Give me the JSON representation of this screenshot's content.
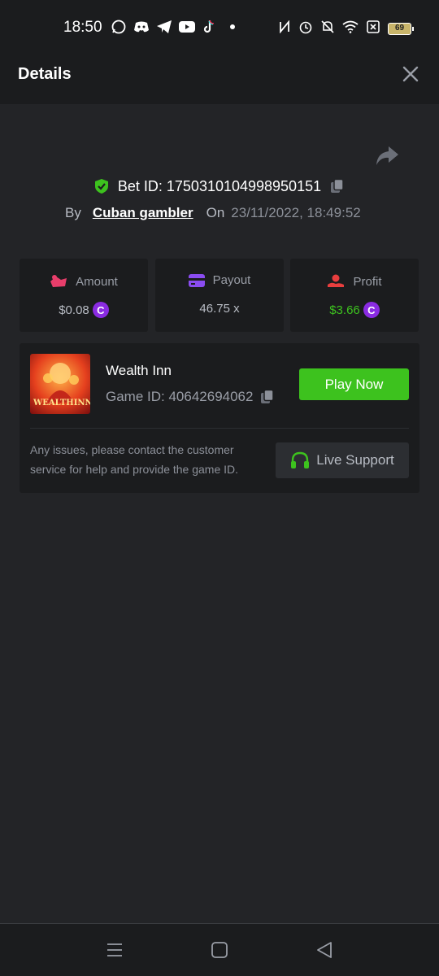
{
  "status_bar": {
    "time": "18:50",
    "battery": "69",
    "left_icons": [
      "whatsapp-icon",
      "discord-icon",
      "telegram-icon",
      "youtube-icon",
      "tiktok-icon",
      "dot-icon"
    ],
    "right_icons": [
      "nfc-icon",
      "alarm-icon",
      "mute-icon",
      "wifi-icon",
      "sim-icon",
      "battery-icon"
    ]
  },
  "header": {
    "title": "Details"
  },
  "bet": {
    "id_label": "Bet ID: 1750310104998950151",
    "by_label": "By",
    "user": "Cuban gambler",
    "on_label": "On",
    "date": "23/11/2022, 18:49:52"
  },
  "stats": {
    "amount": {
      "label": "Amount",
      "value": "$0.08"
    },
    "payout": {
      "label": "Payout",
      "value": "46.75 x"
    },
    "profit": {
      "label": "Profit",
      "value": "$3.66"
    }
  },
  "game": {
    "thumb_text": "WEALTHINN",
    "name": "Wealth Inn",
    "id_label": "Game ID: 40642694062",
    "play_label": "Play Now",
    "issue_text": "Any issues, please contact the customer service for help and provide the game ID.",
    "support_label": "Live Support"
  },
  "colors": {
    "background": "#232427",
    "card": "#1b1c1e",
    "accent_green": "#3dc21e",
    "profit_green": "#3dc21e",
    "coin_purple": "#8a2be2"
  }
}
